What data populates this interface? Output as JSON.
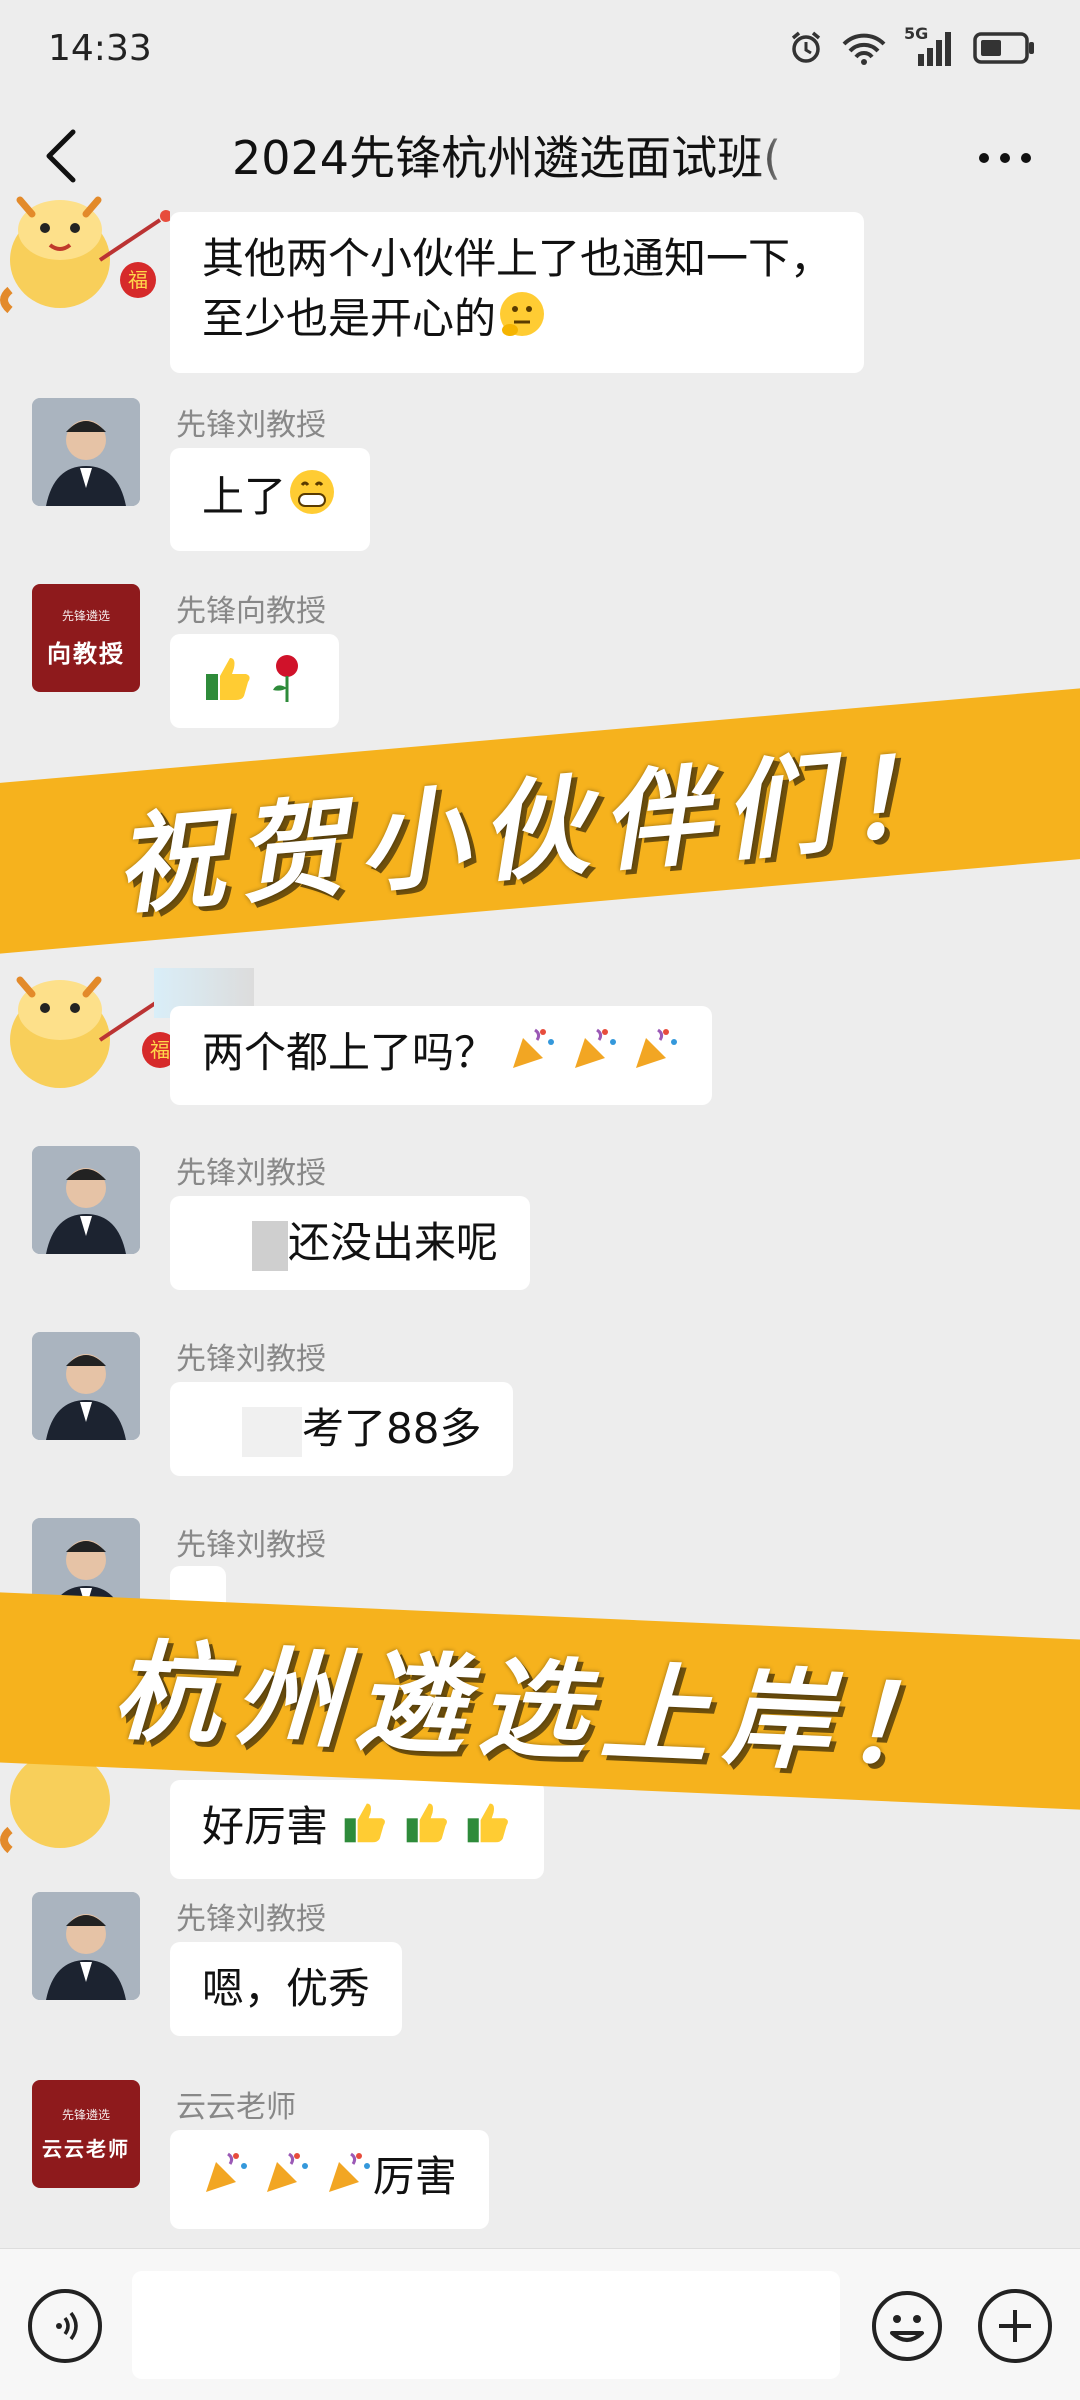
{
  "status_bar": {
    "time": "14:33",
    "network": "5G"
  },
  "header": {
    "title": "2024先锋杭州遴选面试班("
  },
  "messages": [
    {
      "sender": "",
      "text": "其他两个小伙伴上了也通知一下，",
      "text2": "至少也是开心的"
    },
    {
      "sender": "先锋刘教授",
      "text": "上了"
    },
    {
      "sender": "先锋向教授",
      "avatar_text": "向教授",
      "avatar_brand": "先锋遴选"
    },
    {
      "sender": "",
      "text": "两个都上了吗？"
    },
    {
      "sender": "先锋刘教授",
      "text": "还没出来呢"
    },
    {
      "sender": "先锋刘教授",
      "text": "考了88多"
    },
    {
      "sender": "先锋刘教授"
    },
    {
      "sender": "",
      "text": "好厉害"
    },
    {
      "sender": "先锋刘教授",
      "text": "嗯，优秀"
    },
    {
      "sender": "云云老师",
      "avatar_text": "云云老师",
      "avatar_brand": "先锋遴选",
      "text": "厉害"
    }
  ],
  "banners": [
    {
      "text": "祝贺小伙伴们！"
    },
    {
      "text": "杭州遴选上岸！"
    }
  ],
  "sticker_badge": "福",
  "colors": {
    "banner": "#f6b21d",
    "background": "#ededed",
    "bubble": "#ffffff",
    "avatar_red": "#8e1a1c"
  },
  "icons": [
    "back-arrow-icon",
    "more-icon",
    "voice-icon",
    "emoji-icon",
    "plus-icon"
  ]
}
